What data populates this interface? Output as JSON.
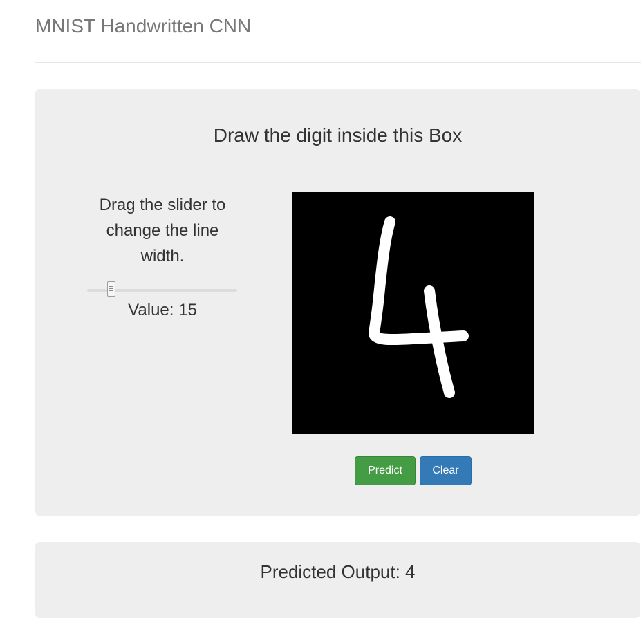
{
  "header": {
    "title": "MNIST Handwritten CNN"
  },
  "draw_panel": {
    "title": "Draw the digit inside this Box",
    "slider_instructions": "Drag the slider to change the line width.",
    "slider": {
      "value_label": "Value: 15",
      "value": 15,
      "fraction": 0.14
    },
    "canvas": {
      "background_color": "#000000",
      "stroke_color": "#ffffff",
      "drawn_digit": "4"
    },
    "buttons": {
      "predict_label": "Predict",
      "clear_label": "Clear"
    }
  },
  "output_panel": {
    "label": "Predicted Output: 4"
  },
  "colors": {
    "panel_bg": "#eeeeee",
    "predict_button": "#449d44",
    "clear_button": "#337ab7",
    "header_text": "#777777"
  }
}
